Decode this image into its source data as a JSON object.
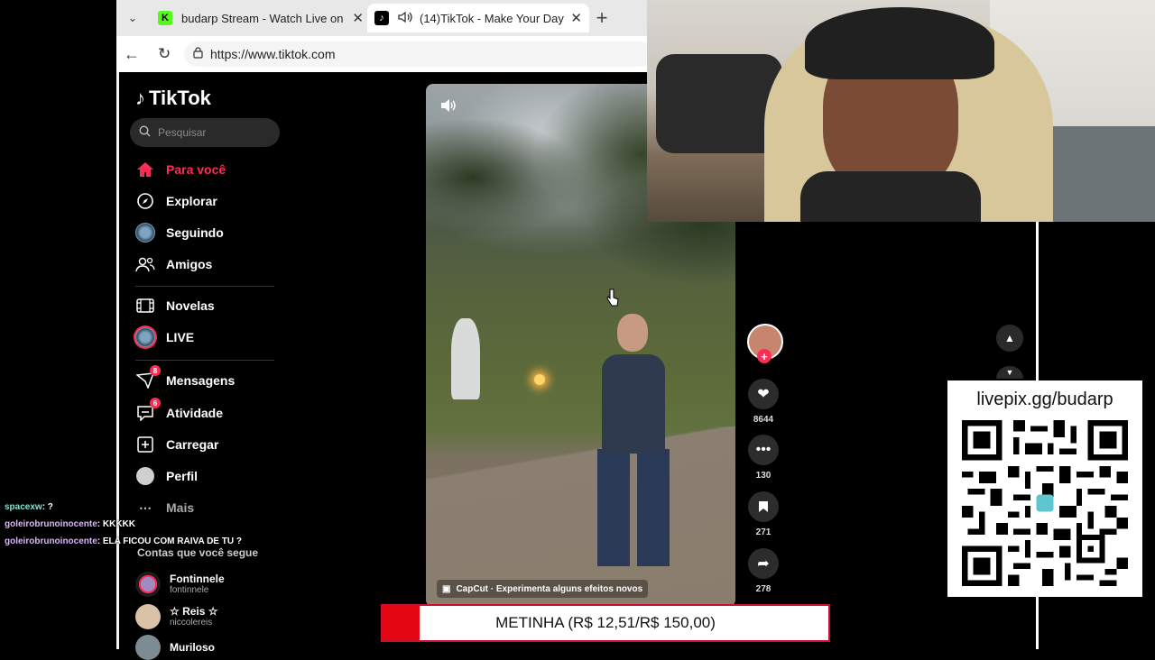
{
  "browser": {
    "tabs": [
      {
        "title": "budarp Stream - Watch Live on Kick",
        "favicon": "K"
      },
      {
        "title": "(14)TikTok - Make Your Day",
        "favicon": "♪"
      }
    ],
    "url": "https://www.tiktok.com"
  },
  "tiktok": {
    "logo": "TikTok",
    "search_placeholder": "Pesquisar",
    "nav": [
      {
        "label": "Para você",
        "icon": "home-icon",
        "active": true
      },
      {
        "label": "Explorar",
        "icon": "compass-icon"
      },
      {
        "label": "Seguindo",
        "icon": "following-avatar-icon"
      },
      {
        "label": "Amigos",
        "icon": "friends-icon"
      },
      {
        "label": "Novelas",
        "icon": "film-icon"
      },
      {
        "label": "LIVE",
        "icon": "live-icon"
      },
      {
        "label": "Mensagens",
        "icon": "message-icon",
        "badge": "8"
      },
      {
        "label": "Atividade",
        "icon": "activity-icon",
        "badge": "6"
      },
      {
        "label": "Carregar",
        "icon": "upload-icon"
      },
      {
        "label": "Perfil",
        "icon": "profile-icon"
      },
      {
        "label": "Mais",
        "icon": "more-icon"
      }
    ],
    "following_title": "Contas que você segue",
    "following": [
      {
        "name": "Fontinnele",
        "handle": "fontinnele"
      },
      {
        "name": "☆ Reis ☆",
        "handle": "niccolereis"
      },
      {
        "name": "Muriloso",
        "handle": ""
      }
    ],
    "video": {
      "caption": "CapCut · Experimenta alguns efeitos novos"
    },
    "actions": {
      "likes": "8644",
      "comments": "130",
      "saves": "271",
      "shares": "278"
    }
  },
  "chat": [
    {
      "user": "spacexw",
      "message": ": ?"
    },
    {
      "user": "goleirobrunoinocente",
      "message": ": KKKKK"
    },
    {
      "user": "goleirobrunoinocente",
      "message": ": ELA FICOU COM RAIVA DE TU ?"
    }
  ],
  "qr": {
    "label": "livepix.gg/budarp"
  },
  "goal": {
    "text": "METINHA (R$ 12,51/R$ 150,00)",
    "progress": 0.0834
  },
  "colors": {
    "tiktok_red": "#fe2c55",
    "goal_red": "#e30613"
  }
}
